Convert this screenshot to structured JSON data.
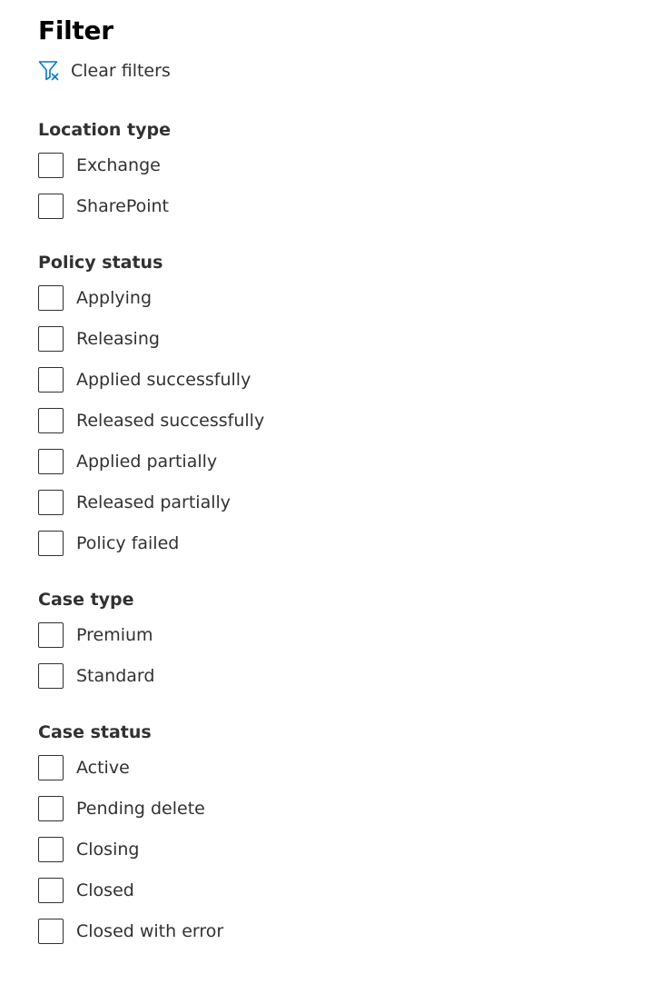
{
  "panel": {
    "title": "Filter",
    "clear_filters": "Clear filters",
    "accent_color": "#0078d4"
  },
  "sections": {
    "location_type": {
      "title": "Location type",
      "options": [
        "Exchange",
        "SharePoint"
      ]
    },
    "policy_status": {
      "title": "Policy status",
      "options": [
        "Applying",
        "Releasing",
        "Applied successfully",
        "Released successfully",
        "Applied partially",
        "Released partially",
        "Policy failed"
      ]
    },
    "case_type": {
      "title": "Case type",
      "options": [
        "Premium",
        "Standard"
      ]
    },
    "case_status": {
      "title": "Case status",
      "options": [
        "Active",
        "Pending delete",
        "Closing",
        "Closed",
        "Closed with error"
      ]
    }
  },
  "icons": {
    "clear_filters": "filter-clear-icon",
    "checkbox": "checkbox-unchecked"
  }
}
